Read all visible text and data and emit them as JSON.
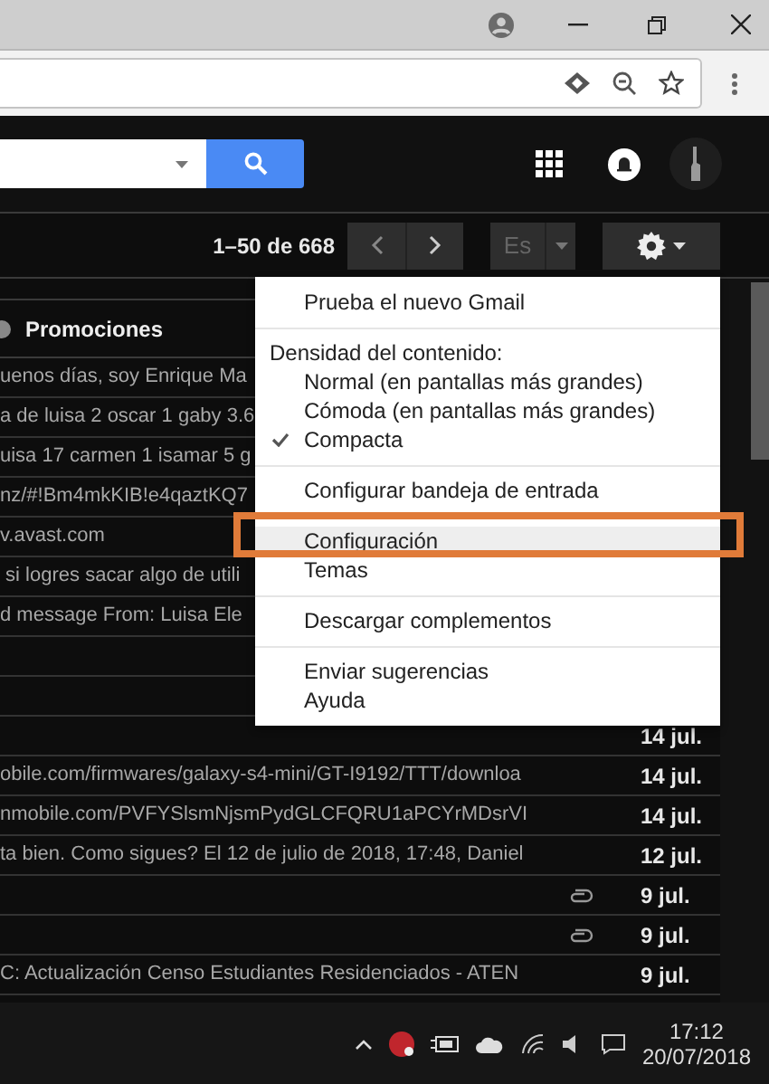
{
  "gmail": {
    "pagination": "1–50 de 668",
    "input_tool": "Es"
  },
  "category_tab": {
    "label": "Promociones"
  },
  "rows": [
    {
      "snippet": "uenos días, soy Enrique Ma",
      "date": "",
      "attachment": false
    },
    {
      "snippet": "a de luisa 2 oscar 1 gaby 3.6",
      "date": "",
      "attachment": false
    },
    {
      "snippet": "uisa 17 carmen 1 isamar 5 g",
      "date": "",
      "attachment": false
    },
    {
      "snippet": "nz/#!Bm4mkKIB!e4qaztKQ7",
      "date": "",
      "attachment": false
    },
    {
      "snippet": "v.avast.com",
      "date": "",
      "attachment": false
    },
    {
      "snippet": " si logres sacar algo de utili",
      "date": "",
      "attachment": false
    },
    {
      "snippet": "d message From: Luisa Ele",
      "date": "",
      "attachment": false
    },
    {
      "snippet": "",
      "date": "",
      "attachment": false
    },
    {
      "snippet": "",
      "date": "",
      "attachment": false
    },
    {
      "snippet": "",
      "date": "14 jul.",
      "attachment": false
    },
    {
      "snippet": "obile.com/firmwares/galaxy-s4-mini/GT-I9192/TTT/downloa",
      "date": "14 jul.",
      "attachment": false
    },
    {
      "snippet": "nmobile.com/PVFYSlsmNjsmPydGLCFQRU1aPCYrMDsrVI",
      "date": "14 jul.",
      "attachment": false
    },
    {
      "snippet": "ta bien. Como sigues? El 12 de julio de 2018, 17:48, Daniel",
      "date": "12 jul.",
      "attachment": false
    },
    {
      "snippet": "",
      "date": "9 jul.",
      "attachment": true
    },
    {
      "snippet": "",
      "date": "9 jul.",
      "attachment": true
    },
    {
      "snippet": "C: Actualización Censo Estudiantes Residenciados - ATEN",
      "date": "9 jul.",
      "attachment": false
    }
  ],
  "settings_menu": {
    "sections": [
      [
        {
          "kind": "item",
          "label": "Prueba el nuevo Gmail",
          "highlighted": false
        }
      ],
      [
        {
          "kind": "header",
          "label": "Densidad del contenido:"
        },
        {
          "kind": "option",
          "label": "Normal (en pantallas más grandes)",
          "selected": false
        },
        {
          "kind": "option",
          "label": "Cómoda (en pantallas más grandes)",
          "selected": false
        },
        {
          "kind": "option",
          "label": "Compacta",
          "selected": true
        }
      ],
      [
        {
          "kind": "item",
          "label": "Configurar bandeja de entrada",
          "highlighted": false
        }
      ],
      [
        {
          "kind": "item",
          "label": "Configuración",
          "highlighted": true
        },
        {
          "kind": "item",
          "label": "Temas",
          "highlighted": false
        }
      ],
      [
        {
          "kind": "item",
          "label": "Descargar complementos",
          "highlighted": false
        }
      ],
      [
        {
          "kind": "item",
          "label": "Enviar sugerencias",
          "highlighted": false
        },
        {
          "kind": "item",
          "label": "Ayuda",
          "highlighted": false
        }
      ]
    ]
  },
  "taskbar": {
    "time": "17:12",
    "date": "20/07/2018"
  }
}
